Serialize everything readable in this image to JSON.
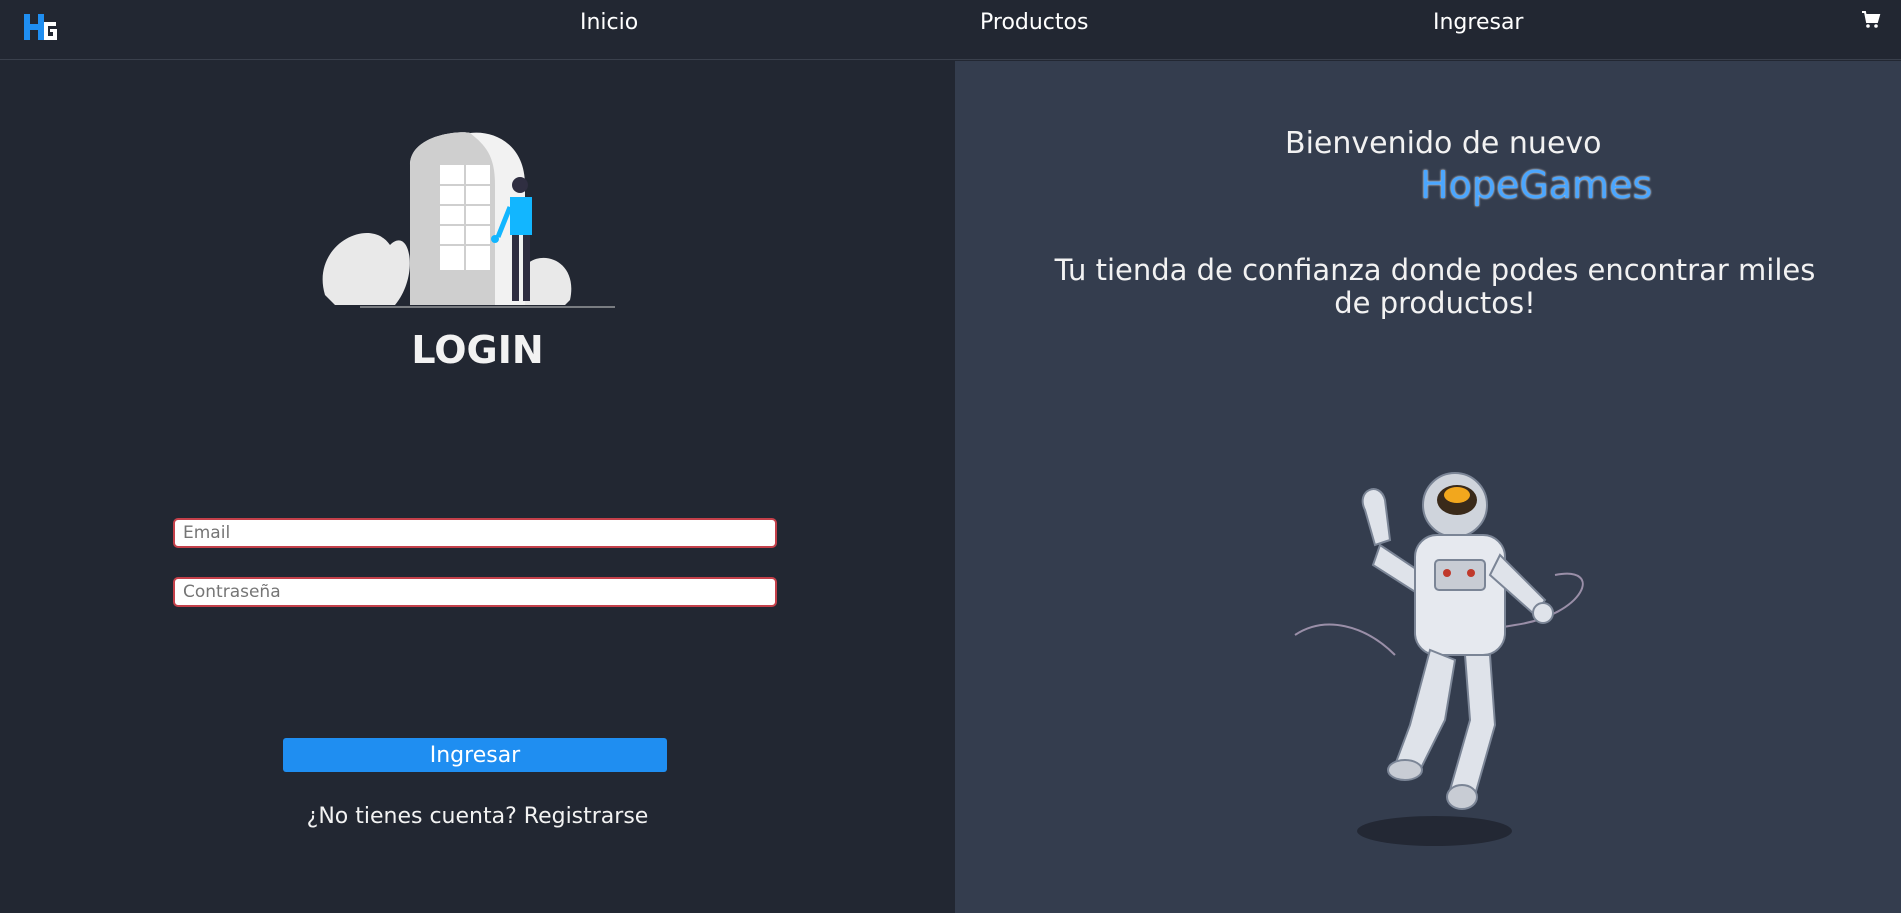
{
  "nav": {
    "items": [
      "Inicio",
      "Productos",
      "Ingresar"
    ],
    "logo_icon": "hopegames-logo",
    "cart_icon": "cart-icon"
  },
  "login": {
    "title": "LOGIN",
    "email_placeholder": "Email",
    "password_placeholder": "Contraseña",
    "submit_label": "Ingresar",
    "no_account_text": "¿No tienes cuenta?",
    "register_link": "Registrarse"
  },
  "hero": {
    "welcome": "Bienvenido de nuevo",
    "brand": "HopeGames",
    "tagline": "Tu tienda de confianza donde podes encontrar miles de productos!"
  },
  "colors": {
    "background": "#222732",
    "panel": "#343d4e",
    "accent": "#1f8ef1",
    "brand_text": "#4aa6ff",
    "field_border": "#c4404a"
  }
}
